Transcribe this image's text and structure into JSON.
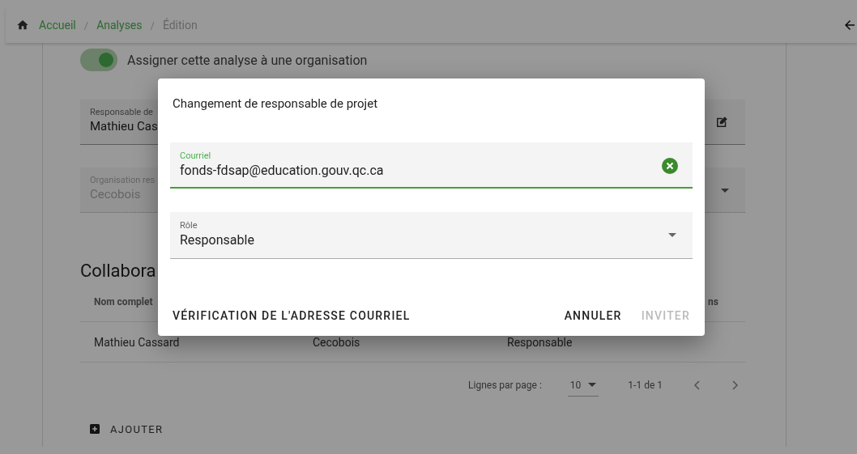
{
  "breadcrumb": {
    "items": [
      {
        "label": "Accueil",
        "kind": "link"
      },
      {
        "label": "Analyses",
        "kind": "link"
      },
      {
        "label": "Édition",
        "kind": "current"
      }
    ],
    "separators": [
      "/",
      "/"
    ]
  },
  "org_toggle": {
    "label": "Assigner cette analyse à une organisation",
    "on": true
  },
  "responsable_field": {
    "label": "Responsable de",
    "value": "Mathieu Cas"
  },
  "organisation_field": {
    "label": "Organisation res",
    "value": "Cecobois",
    "disabled": true
  },
  "collaborators": {
    "title": "Collabora",
    "columns": [
      "Nom complet",
      "ns"
    ],
    "rows": [
      {
        "cells": [
          "Mathieu Cassard",
          "Cecobois",
          "Responsable"
        ]
      }
    ],
    "pagination": {
      "rows_per_page_label": "Lignes par page :",
      "rows_per_page": "10",
      "range": "1-1 de 1"
    },
    "add_button": "AJOUTER"
  },
  "dialog": {
    "title": "Changement de responsable de projet",
    "email_field": {
      "label": "Courriel",
      "value": "fonds-fdsap@education.gouv.qc.ca",
      "focused": true
    },
    "role_field": {
      "label": "Rôle",
      "value": "Responsable"
    },
    "actions": [
      {
        "label": "VÉRIFICATION DE L'ADRESSE COURRIEL",
        "disabled": false
      },
      {
        "label": "ANNULER",
        "disabled": false
      },
      {
        "label": "INVITER",
        "disabled": true
      }
    ]
  }
}
